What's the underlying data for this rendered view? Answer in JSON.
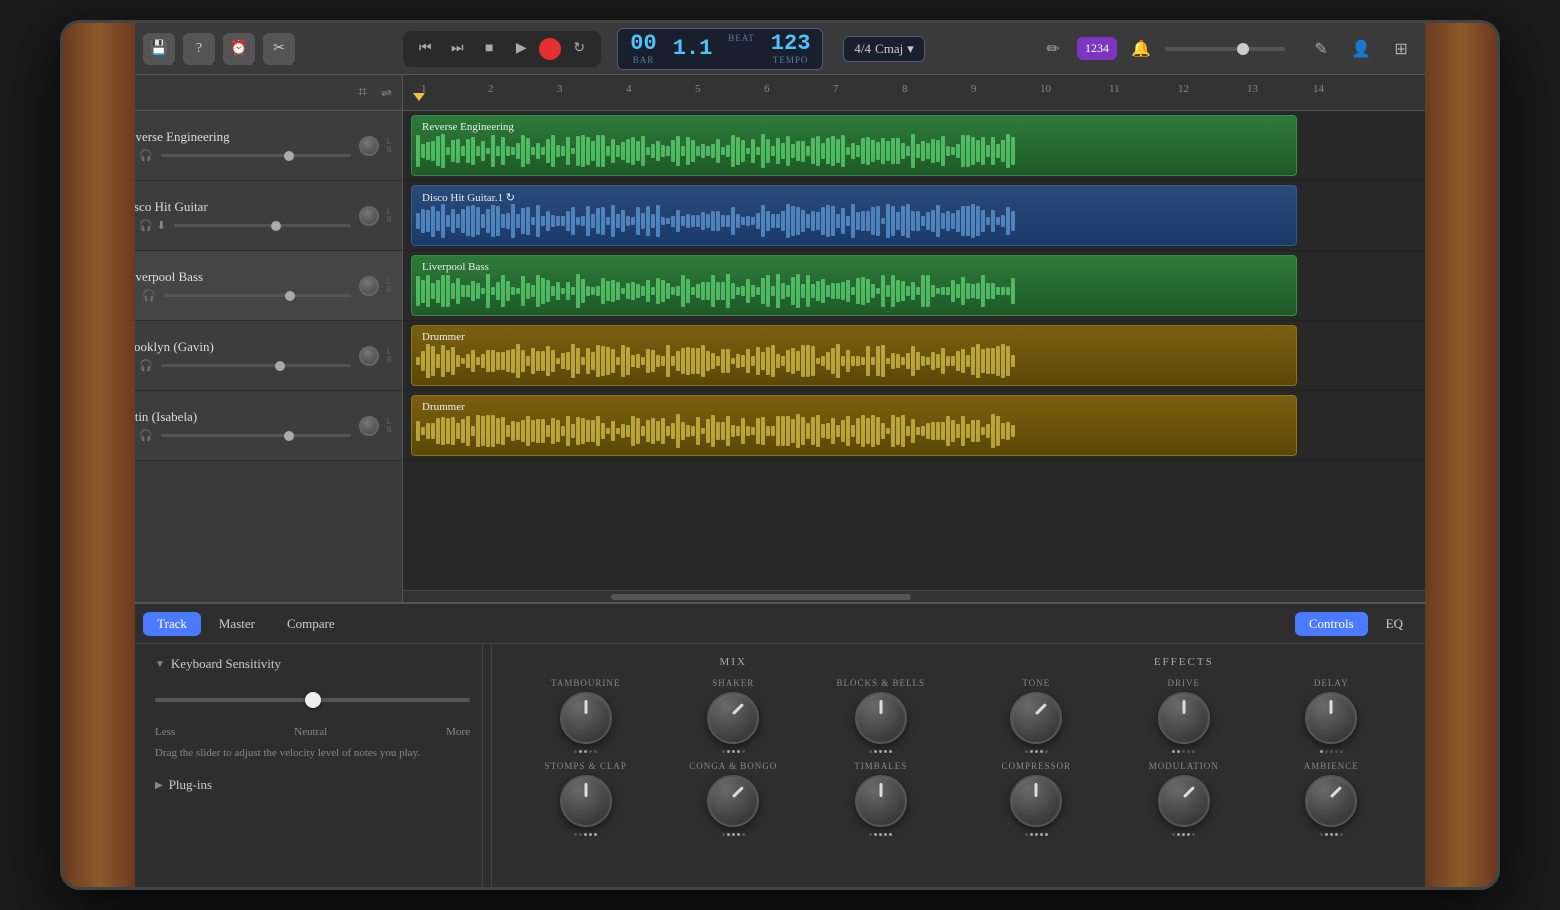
{
  "toolbar": {
    "time": {
      "bar": "00",
      "beat": "1.1",
      "tempo": "123",
      "tempo_label": "TEMPO",
      "bar_label": "BAR",
      "beat_label": "BEAT",
      "key": "4/4",
      "scale": "Cmaj"
    },
    "count_in_label": "1234",
    "buttons": {
      "rewind": "⏮",
      "fast_forward": "⏭",
      "stop": "■",
      "play": "▶",
      "cycle": "↻"
    }
  },
  "tracks": [
    {
      "name": "Reverse Engineering",
      "icon": "🎹",
      "color": "green",
      "type": "keyboard"
    },
    {
      "name": "Disco Hit Guitar.1",
      "icon": "🎸",
      "color": "blue",
      "type": "guitar"
    },
    {
      "name": "Liverpool Bass",
      "icon": "🎸",
      "color": "green",
      "type": "bass"
    },
    {
      "name": "Brooklyn (Gavin)",
      "icon": "🥁",
      "color": "gold",
      "type": "drummer"
    },
    {
      "name": "Latin (Isabela)",
      "icon": "🪘",
      "color": "gold",
      "type": "percussionist"
    }
  ],
  "ruler": {
    "marks": [
      "1",
      "2",
      "3",
      "4",
      "5",
      "6",
      "7",
      "8",
      "9",
      "10",
      "11",
      "12",
      "13",
      "14"
    ]
  },
  "bottom_panel": {
    "tabs": [
      "Track",
      "Master",
      "Compare"
    ],
    "active_tab": "Track",
    "right_tabs": [
      "Controls",
      "EQ"
    ],
    "active_right_tab": "Controls",
    "keyboard_sensitivity": {
      "title": "Keyboard Sensitivity",
      "labels": {
        "less": "Less",
        "neutral": "Neutral",
        "more": "More"
      },
      "description": "Drag the slider to adjust the velocity level of notes you play."
    },
    "plugins_label": "Plug-ins",
    "mix_label": "MIX",
    "effects_label": "EFFECTS",
    "mix_knobs": [
      {
        "label": "TAMBOURINE",
        "position": "low"
      },
      {
        "label": "SHAKER",
        "position": "mid"
      },
      {
        "label": "BLOCKS & BELLS",
        "position": "mid-high"
      },
      {
        "label": "STOMPS & CLAP",
        "position": "high"
      },
      {
        "label": "CONGA & BONGO",
        "position": "mid"
      },
      {
        "label": "TIMBALES",
        "position": "mid-high"
      }
    ],
    "effects_knobs": [
      {
        "label": "TONE",
        "position": "mid"
      },
      {
        "label": "DRIVE",
        "position": "low"
      },
      {
        "label": "DELAY",
        "position": "low"
      },
      {
        "label": "COMPRESSOR",
        "position": "mid-high"
      },
      {
        "label": "MODULATION",
        "position": "mid"
      },
      {
        "label": "AMBIENCE",
        "position": "mid"
      }
    ]
  }
}
